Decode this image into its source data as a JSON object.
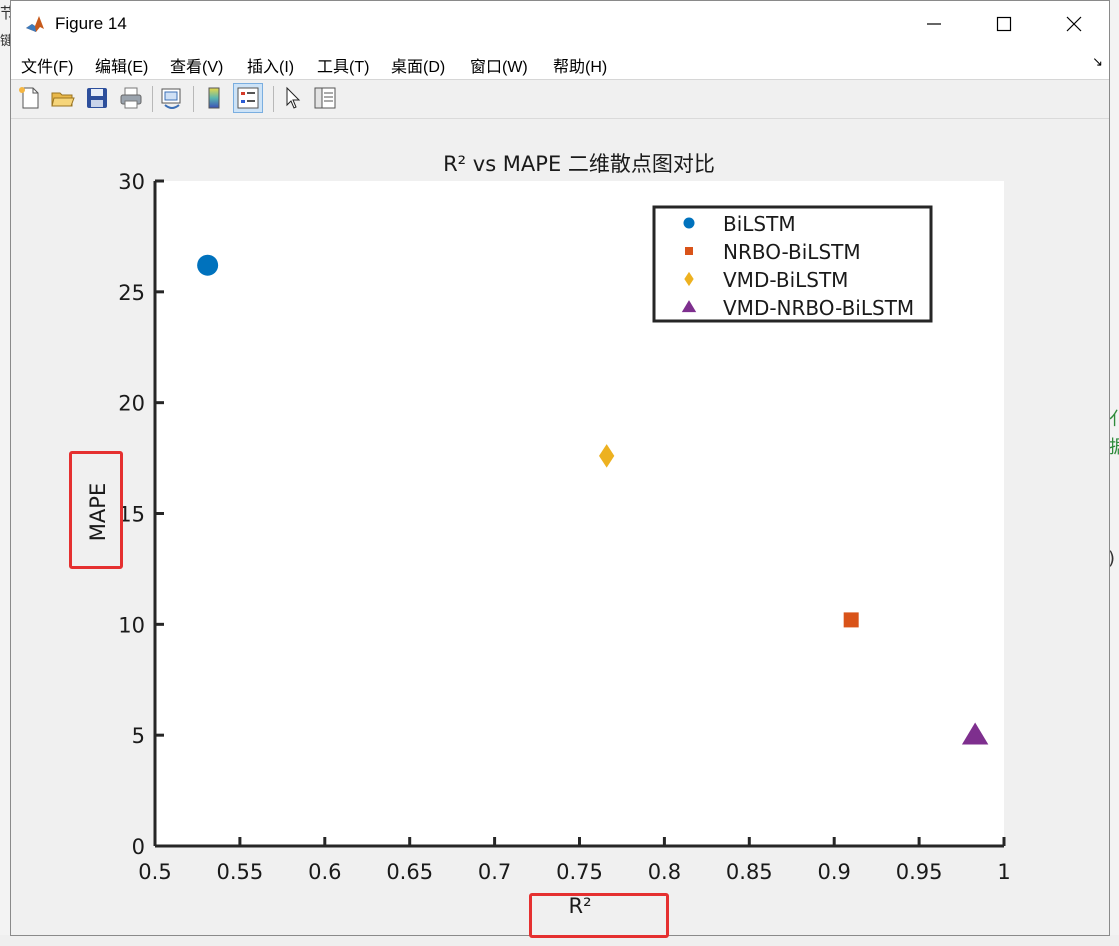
{
  "window": {
    "title": "Figure 14"
  },
  "menu": {
    "items": [
      {
        "label": "文件(F)",
        "accel": "F"
      },
      {
        "label": "编辑(E)",
        "accel": "E"
      },
      {
        "label": "查看(V)",
        "accel": "V"
      },
      {
        "label": "插入(I)",
        "accel": "I"
      },
      {
        "label": "工具(T)",
        "accel": "T"
      },
      {
        "label": "桌面(D)",
        "accel": "D"
      },
      {
        "label": "窗口(W)",
        "accel": "W"
      },
      {
        "label": "帮助(H)",
        "accel": "H"
      }
    ]
  },
  "toolbar": {
    "icons": [
      "new-figure-icon",
      "open-file-icon",
      "save-icon",
      "print-icon",
      "link-plot-icon",
      "colorbar-icon",
      "legend-icon",
      "pointer-icon",
      "property-editor-icon"
    ],
    "active": "legend-icon"
  },
  "background_fragments": {
    "left_top": "节",
    "left_second": "键",
    "right_a": "亻",
    "right_b": "据",
    "right_c": ")"
  },
  "colors": {
    "bilstm": "#0072BD",
    "nrbo": "#D95319",
    "vmd": "#EDB120",
    "vmd_nrbo": "#7E2F8E",
    "annotation": "#e53030"
  },
  "chart_data": {
    "type": "scatter",
    "title": "R² vs MAPE 二维散点图对比",
    "xlabel": "R²",
    "ylabel": "MAPE",
    "xlim": [
      0.5,
      1
    ],
    "ylim": [
      0,
      30
    ],
    "xticks": [
      "0.5",
      "0.55",
      "0.6",
      "0.65",
      "0.7",
      "0.75",
      "0.8",
      "0.85",
      "0.9",
      "0.95",
      "1"
    ],
    "yticks": [
      "0",
      "5",
      "10",
      "15",
      "20",
      "25",
      "30"
    ],
    "grid": false,
    "legend_position": "top-right",
    "series": [
      {
        "name": "BiLSTM",
        "marker": "circle",
        "x": 0.531,
        "y": 26.2
      },
      {
        "name": "NRBO-BiLSTM",
        "marker": "square",
        "x": 0.91,
        "y": 10.2
      },
      {
        "name": "VMD-BiLSTM",
        "marker": "diamond",
        "x": 0.766,
        "y": 17.6
      },
      {
        "name": "VMD-NRBO-BiLSTM",
        "marker": "triangle",
        "x": 0.983,
        "y": 5.0
      }
    ]
  }
}
